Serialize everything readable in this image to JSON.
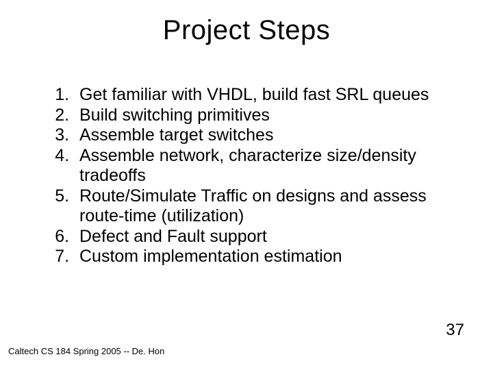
{
  "title": "Project Steps",
  "steps": [
    "Get familiar with VHDL, build fast SRL queues",
    "Build switching primitives",
    "Assemble target switches",
    "Assemble network, characterize size/density tradeoffs",
    "Route/Simulate Traffic on designs and assess route-time (utilization)",
    "Defect and Fault support",
    "Custom implementation estimation"
  ],
  "footer": "Caltech CS 184 Spring 2005 -- De. Hon",
  "page_number": "37"
}
